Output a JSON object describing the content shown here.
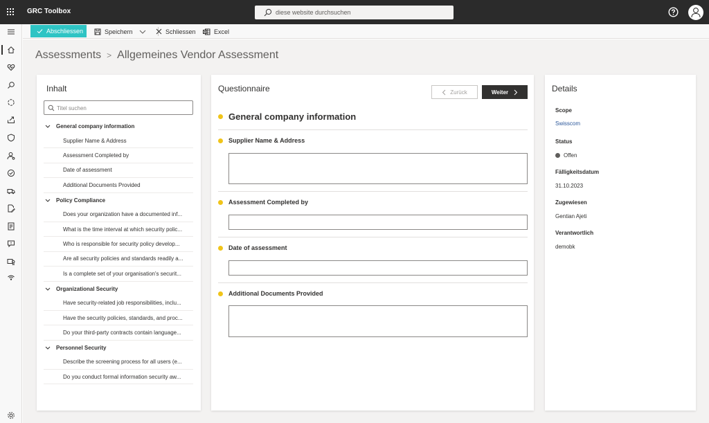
{
  "app": {
    "title": "GRC Toolbox"
  },
  "search": {
    "placeholder": "diese website durchsuchen"
  },
  "commandbar": {
    "complete_label": "Abschliessen",
    "save_label": "Speichern",
    "close_label": "Schliessen",
    "excel_label": "Excel"
  },
  "breadcrumb": {
    "parent": "Assessments",
    "current": "Allgemeines Vendor Assessment"
  },
  "content_panel": {
    "title": "Inhalt",
    "search_placeholder": "Titel suchen",
    "sections": [
      {
        "label": "General company information",
        "items": [
          "Supplier Name & Address",
          "Assessment Completed by",
          "Date of assessment",
          "Additional Documents Provided"
        ]
      },
      {
        "label": "Policy Compliance",
        "items": [
          "Does your organization have a documented inf...",
          "What is the time interval at which security polic...",
          "Who is responsible for security policy develop...",
          "Are all security policies and standards readily a...",
          "Is a complete set of your organisation's securit..."
        ]
      },
      {
        "label": "Organizational Security",
        "items": [
          "Have security-related job responsibilities, inclu...",
          "Have the security policies, standards, and proc...",
          "Do your third-party contracts contain language..."
        ]
      },
      {
        "label": "Personnel Security",
        "items": [
          "Describe the screening process for all users (e...",
          "Do you conduct formal information security aw..."
        ]
      }
    ]
  },
  "questionnaire": {
    "title": "Questionnaire",
    "back_label": "Zurück",
    "next_label": "Weiter",
    "section_heading": "General company information",
    "questions": [
      {
        "label": "Supplier Name & Address",
        "value": ""
      },
      {
        "label": "Assessment Completed by",
        "value": ""
      },
      {
        "label": "Date of assessment",
        "value": ""
      },
      {
        "label": "Additional Documents Provided",
        "value": ""
      }
    ]
  },
  "details": {
    "title": "Details",
    "scope_label": "Scope",
    "scope_value": "Swisscom",
    "status_label": "Status",
    "status_value": "Offen",
    "due_label": "Fälligkeitsdatum",
    "due_value": "31.10.2023",
    "assigned_label": "Zugewiesen",
    "assigned_value": "Gentian Ajeti",
    "responsible_label": "Verantwortlich",
    "responsible_value": "demobk"
  },
  "colors": {
    "accent": "#2ec4c4",
    "topbar": "#2b2b2b",
    "required_dot": "#f0c419",
    "link": "#2b579a"
  }
}
